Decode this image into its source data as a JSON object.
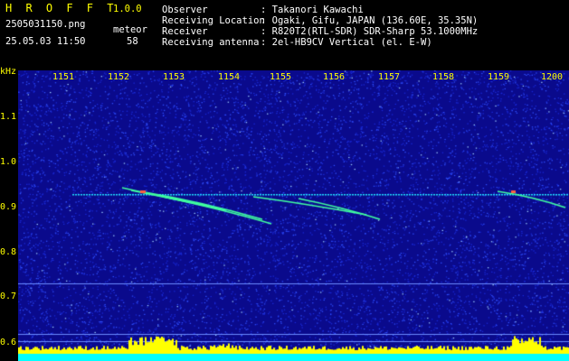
{
  "header": {
    "app_title": "H R O F F T",
    "version": "1.0.0",
    "filename": "2505031150.png",
    "datetime": "25.05.03 11:50",
    "meteor_label": "meteor",
    "meteor_count": "58",
    "info": [
      {
        "key": "Observer",
        "value": ": Takanori Kawachi"
      },
      {
        "key": "Receiving Location",
        "value": ": Ogaki, Gifu, JAPAN (136.60E, 35.35N)"
      },
      {
        "key": "Receiver",
        "value": ": R820T2(RTL-SDR) SDR-Sharp 53.1000MHz"
      },
      {
        "key": "Receiving antenna",
        "value": ": 2el-HB9CV Vertical (el. E-W)"
      }
    ]
  },
  "spectrogram": {
    "y_unit": "kHz",
    "x_ticks": [
      "1151",
      "1152",
      "1153",
      "1154",
      "1155",
      "1156",
      "1157",
      "1158",
      "1159",
      "1200"
    ],
    "y_ticks": [
      "1.1",
      "1.0",
      "0.9",
      "0.8",
      "0.7",
      "0.6"
    ],
    "colors": {
      "background": "#0a0a8c",
      "noise": "#3050ff",
      "trail": "#40ffa0",
      "carrier": "#20e0ff",
      "bars": "#ffff00",
      "base": "#00ffff"
    }
  }
}
